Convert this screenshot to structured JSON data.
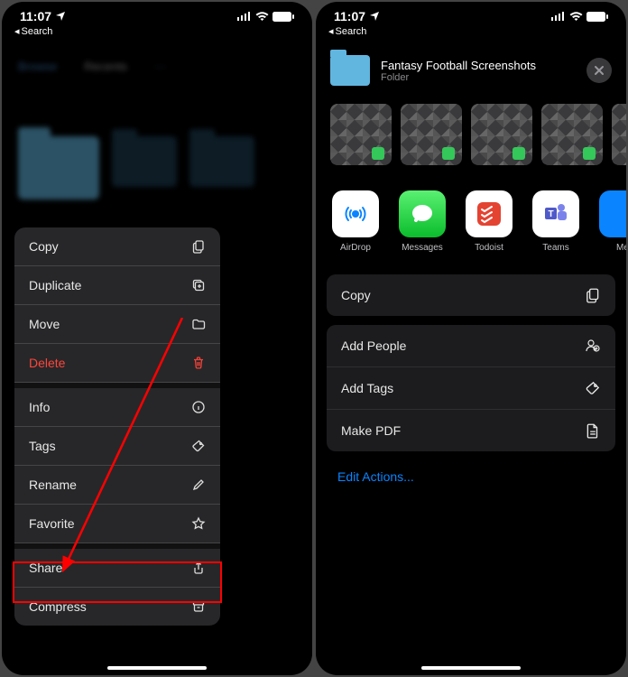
{
  "status": {
    "time": "11:07",
    "back_label": "Search"
  },
  "left": {
    "menu": [
      {
        "label": "Copy",
        "icon": "copy",
        "destructive": false
      },
      {
        "label": "Duplicate",
        "icon": "duplicate",
        "destructive": false
      },
      {
        "label": "Move",
        "icon": "folder",
        "destructive": false
      },
      {
        "label": "Delete",
        "icon": "trash",
        "destructive": true
      },
      {
        "label": "Info",
        "icon": "info",
        "destructive": false,
        "gap": true
      },
      {
        "label": "Tags",
        "icon": "tag",
        "destructive": false
      },
      {
        "label": "Rename",
        "icon": "pencil",
        "destructive": false
      },
      {
        "label": "Favorite",
        "icon": "star",
        "destructive": false
      },
      {
        "label": "Share",
        "icon": "share",
        "destructive": false,
        "gap": true,
        "highlighted": true
      },
      {
        "label": "Compress",
        "icon": "archive",
        "destructive": false
      }
    ]
  },
  "right": {
    "header": {
      "title": "Fantasy Football Screenshots",
      "subtitle": "Folder"
    },
    "apps": [
      {
        "label": "AirDrop",
        "name": "airdrop"
      },
      {
        "label": "Messages",
        "name": "messages"
      },
      {
        "label": "Todoist",
        "name": "todoist"
      },
      {
        "label": "Teams",
        "name": "teams"
      },
      {
        "label": "Me",
        "name": "more"
      }
    ],
    "action_copy": "Copy",
    "actions_group": [
      {
        "label": "Add People",
        "icon": "add-people"
      },
      {
        "label": "Add Tags",
        "icon": "tag"
      },
      {
        "label": "Make PDF",
        "icon": "doc"
      }
    ],
    "edit_actions": "Edit Actions..."
  }
}
